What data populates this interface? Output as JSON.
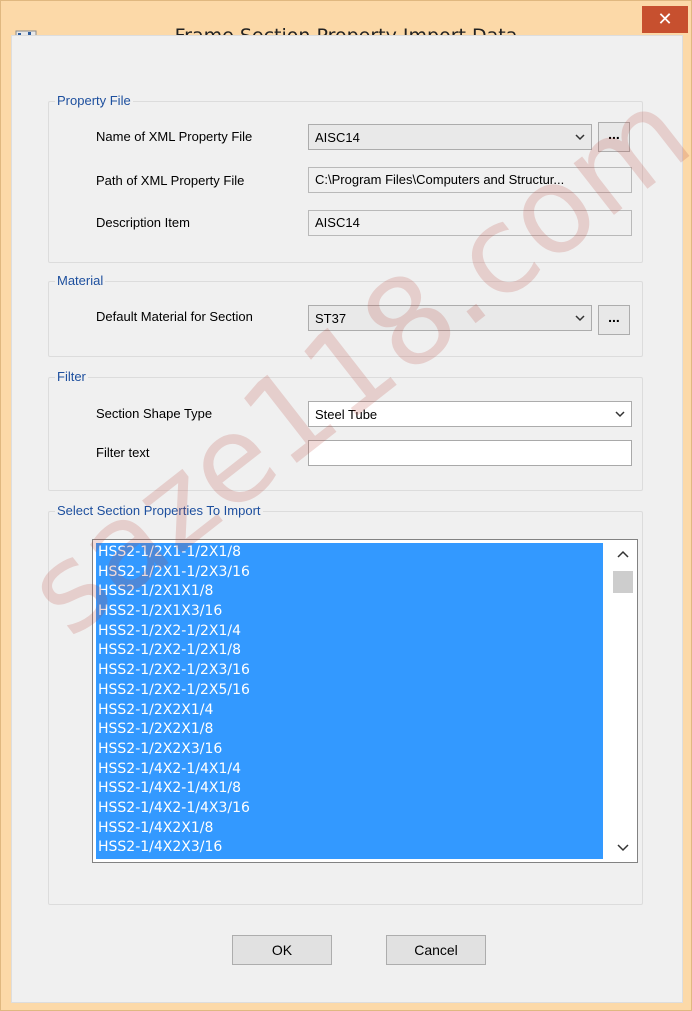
{
  "window": {
    "title": "Frame Section Property Import Data",
    "close_label": "✕"
  },
  "property_file": {
    "group_title": "Property File",
    "xml_name_label": "Name of XML Property File",
    "xml_name_value": "AISC14",
    "xml_path_label": "Path of XML Property File",
    "xml_path_value": "C:\\Program Files\\Computers and Structur...",
    "description_label": "Description Item",
    "description_value": "AISC14",
    "browse_label": "..."
  },
  "material": {
    "group_title": "Material",
    "default_label": "Default Material for Section",
    "default_value": "ST37",
    "browse_label": "..."
  },
  "filter": {
    "group_title": "Filter",
    "shape_label": "Section Shape Type",
    "shape_value": "Steel Tube",
    "text_label": "Filter text",
    "text_value": ""
  },
  "select": {
    "group_title": "Select Section Properties To Import",
    "items": [
      "HSS2-1/2X1-1/2X1/8",
      "HSS2-1/2X1-1/2X3/16",
      "HSS2-1/2X1X1/8",
      "HSS2-1/2X1X3/16",
      "HSS2-1/2X2-1/2X1/4",
      "HSS2-1/2X2-1/2X1/8",
      "HSS2-1/2X2-1/2X3/16",
      "HSS2-1/2X2-1/2X5/16",
      "HSS2-1/2X2X1/4",
      "HSS2-1/2X2X1/8",
      "HSS2-1/2X2X3/16",
      "HSS2-1/4X2-1/4X1/4",
      "HSS2-1/4X2-1/4X1/8",
      "HSS2-1/4X2-1/4X3/16",
      "HSS2-1/4X2X1/8",
      "HSS2-1/4X2X3/16"
    ]
  },
  "buttons": {
    "ok": "OK",
    "cancel": "Cancel"
  },
  "watermark": "saze118.com",
  "colors": {
    "titlebar": "#fcd9a8",
    "close": "#c7502f",
    "group_title": "#1d4f9e",
    "selection": "#3399ff"
  }
}
